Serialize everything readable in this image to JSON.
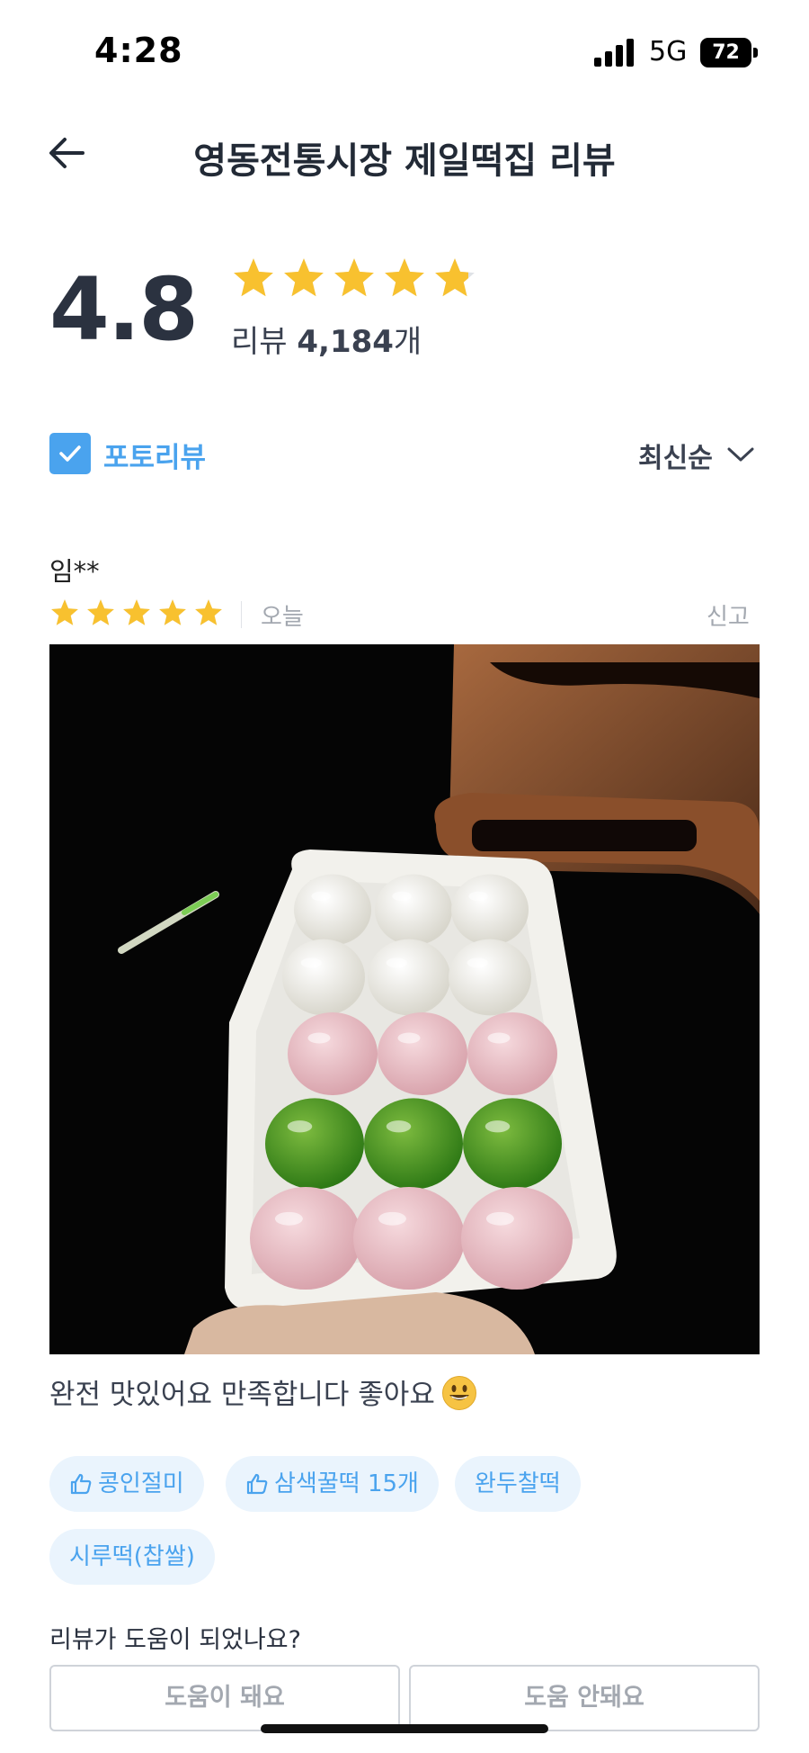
{
  "status_bar": {
    "time": "4:28",
    "network": "5G",
    "battery": "72"
  },
  "header": {
    "title": "영동전통시장 제일떡집 리뷰"
  },
  "rating": {
    "score": "4.8",
    "stars": 4.8,
    "count_prefix": "리뷰 ",
    "count_value": "4,184",
    "count_suffix": "개"
  },
  "filters": {
    "photo_review_label": "포토리뷰",
    "photo_review_checked": true,
    "sort_label": "최신순"
  },
  "review": {
    "author": "임**",
    "stars": 5,
    "date": "오늘",
    "report_label": "신고",
    "text": "완전 맛있어요 만족합니다 좋아요",
    "emoji": "grinning-face",
    "tags": [
      {
        "label": "콩인절미",
        "thumb": true
      },
      {
        "label": "삼색꿀떡 15개",
        "thumb": true
      },
      {
        "label": "완두찰떡",
        "thumb": false
      },
      {
        "label": "시루떡(찹쌀)",
        "thumb": false
      }
    ]
  },
  "helpful": {
    "question": "리뷰가 도움이 되었나요?",
    "yes_label": "도움이 돼요",
    "no_label": "도움 안돼요"
  },
  "colors": {
    "accent": "#4aa3ee",
    "star": "#f8c12f",
    "star_empty": "#dfe2e6",
    "tag_bg": "#eaf4fd"
  }
}
